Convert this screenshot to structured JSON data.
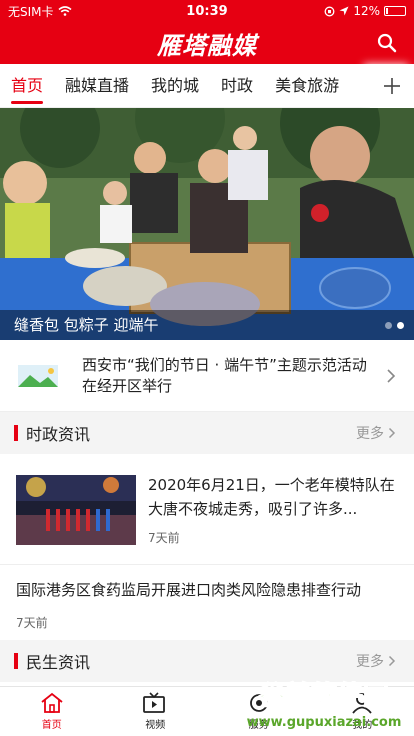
{
  "status_bar": {
    "carrier": "无SIM卡",
    "time": "10:39",
    "battery": "12%",
    "battery_level": 0.12
  },
  "header": {
    "logo": "雁塔融媒"
  },
  "tabs": [
    {
      "label": "首页",
      "active": true
    },
    {
      "label": "融媒直播",
      "active": false
    },
    {
      "label": "我的城",
      "active": false
    },
    {
      "label": "时政",
      "active": false
    },
    {
      "label": "美食旅游",
      "active": false
    }
  ],
  "banner": {
    "caption": "缝香包 包粽子 迎端午",
    "slide_count": 2,
    "active_slide": 2
  },
  "notice": {
    "text": "西安市“我们的节日 · 端午节”主题示范活动在经开区举行"
  },
  "sections": {
    "politics": {
      "title": "时政资讯",
      "more": "更多"
    },
    "livelihood": {
      "title": "民生资讯",
      "more": "更多"
    }
  },
  "news": [
    {
      "title": "2020年6月21日，一个老年模特队在大唐不夜城走秀，吸引了许多...",
      "time": "7天前"
    },
    {
      "title": "国际港务区食药监局开展进口肉类风险隐患排查行动",
      "time": "7天前"
    }
  ],
  "bottom_nav": [
    {
      "label": "首页",
      "icon": "home-icon",
      "active": true
    },
    {
      "label": "视频",
      "icon": "video-icon",
      "active": false
    },
    {
      "label": "服务",
      "icon": "service-icon",
      "active": false
    },
    {
      "label": "我的",
      "icon": "profile-icon",
      "active": false
    }
  ],
  "watermark": {
    "brand": "谷普软件园",
    "url": "www.gupuxiazai.com"
  },
  "colors": {
    "brand": "#e60012",
    "section_bg": "#f4f4f4"
  }
}
